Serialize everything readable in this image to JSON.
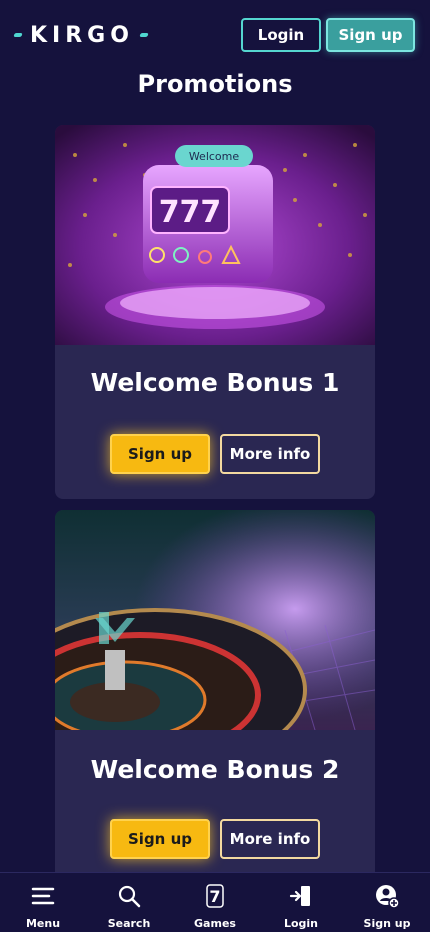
{
  "header": {
    "logo_text": "KIRGO",
    "login_label": "Login",
    "signup_label": "Sign up"
  },
  "page": {
    "title": "Promotions"
  },
  "promotions": [
    {
      "badge": "Welcome",
      "title": "Welcome Bonus 1",
      "primary_label": "Sign up",
      "secondary_label": "More info",
      "image": "slot-machine-777"
    },
    {
      "title": "Welcome Bonus 2",
      "primary_label": "Sign up",
      "secondary_label": "More info",
      "image": "roulette-wheel"
    }
  ],
  "bottom_nav": {
    "items": [
      {
        "label": "Menu",
        "icon": "hamburger-icon"
      },
      {
        "label": "Search",
        "icon": "search-icon"
      },
      {
        "label": "Games",
        "icon": "seven-icon"
      },
      {
        "label": "Login",
        "icon": "login-door-icon"
      },
      {
        "label": "Sign up",
        "icon": "add-user-icon"
      }
    ]
  },
  "colors": {
    "background": "#15123d",
    "card": "#2a2752",
    "accent_teal": "#55d6d0",
    "accent_yellow": "#f7b911"
  }
}
